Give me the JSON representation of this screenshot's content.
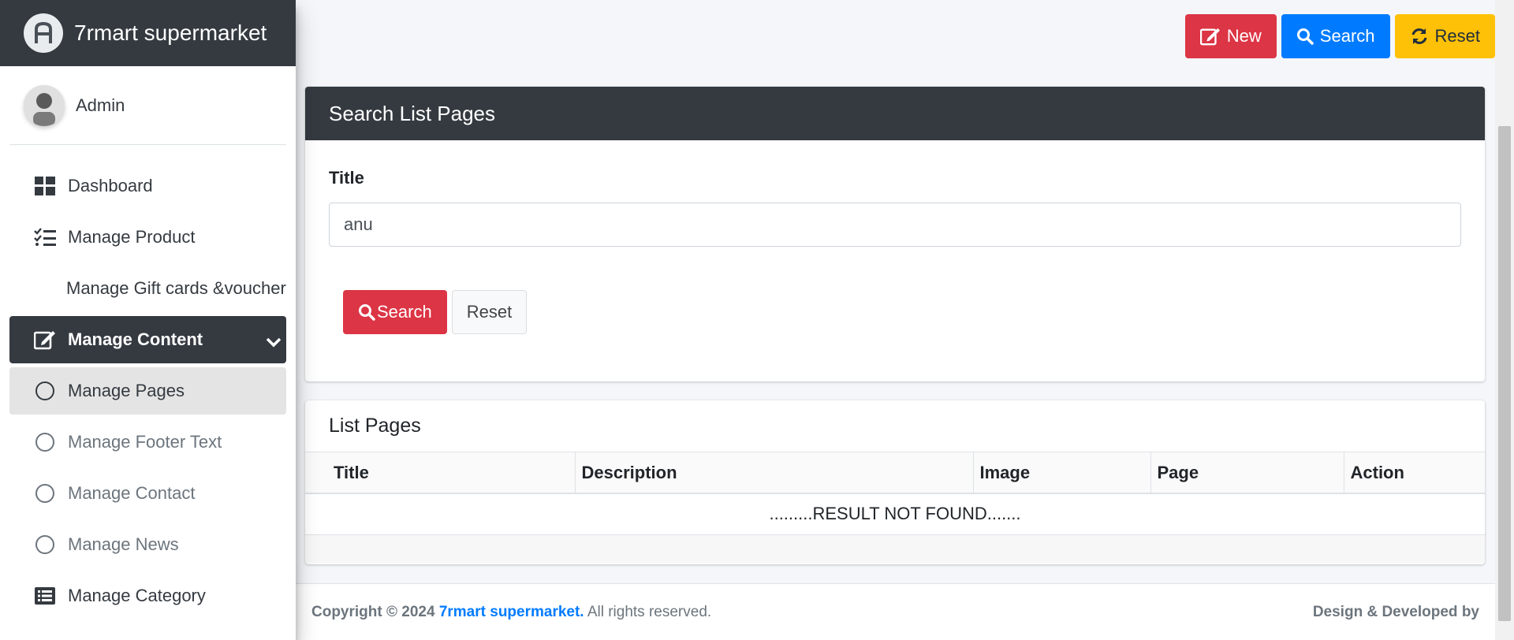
{
  "brand": {
    "name": "7rmart supermarket"
  },
  "user": {
    "name": "Admin"
  },
  "sidebar": {
    "items": [
      {
        "label": "Dashboard",
        "icon": "dashboard-icon"
      },
      {
        "label": "Manage Product",
        "icon": "list-check-icon"
      },
      {
        "label": "Manage Gift cards &voucher",
        "icon": ""
      },
      {
        "label": "Manage Content",
        "icon": "edit-icon",
        "active": true
      },
      {
        "label": "Manage Pages",
        "icon": "circle-icon",
        "selected": true
      },
      {
        "label": "Manage Footer Text",
        "icon": "circle-icon"
      },
      {
        "label": "Manage Contact",
        "icon": "circle-icon"
      },
      {
        "label": "Manage News",
        "icon": "circle-icon"
      },
      {
        "label": "Manage Category",
        "icon": "list-alt-icon"
      }
    ]
  },
  "toolbar": {
    "new_label": "New",
    "search_label": "Search",
    "reset_label": "Reset"
  },
  "search_card": {
    "title": "Search List Pages",
    "field_label": "Title",
    "field_value": "anu",
    "search_label": "Search",
    "reset_label": "Reset"
  },
  "list_card": {
    "title": "List Pages",
    "columns": [
      "Title",
      "Description",
      "Image",
      "Page",
      "Action"
    ],
    "empty_text": ".........RESULT NOT FOUND......."
  },
  "footer": {
    "copyright": "Copyright © 2024",
    "brand_link": "7rmart supermarket.",
    "rights": "All rights reserved.",
    "credit": "Design & Developed by"
  },
  "colors": {
    "dark": "#343a40",
    "danger": "#dc3545",
    "primary": "#007bff",
    "warning": "#ffc107"
  }
}
